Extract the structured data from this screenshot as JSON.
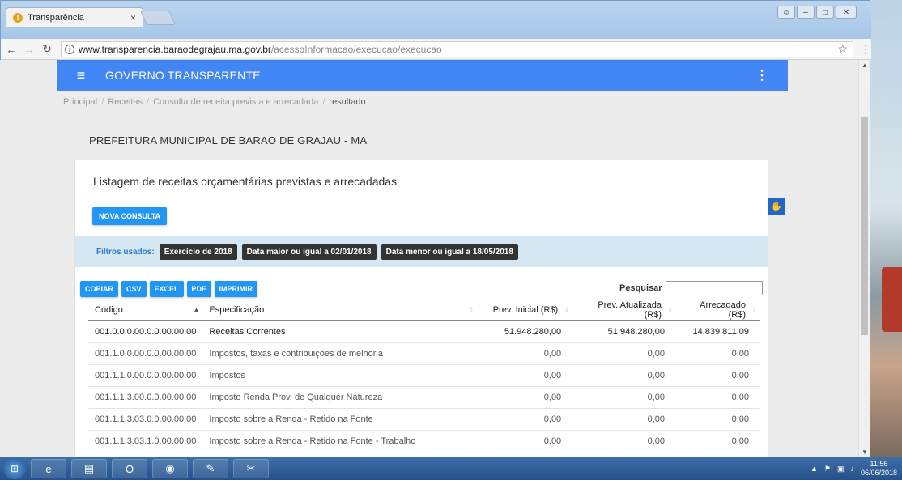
{
  "browser": {
    "tab_title": "Transparência",
    "tab_close": "×",
    "url_host": "www.transparencia.baraodegrajau.ma.gov.br",
    "url_path": "/acessoInformacao/execucao/execucao"
  },
  "app": {
    "brand": "GOVERNO TRANSPARENTE"
  },
  "breadcrumb": [
    "Principal",
    "Receitas",
    "Consulta de receita prevista e arrecadada",
    "resultado"
  ],
  "org_title": "PREFEITURA MUNICIPAL DE BARAO DE GRAJAU - MA",
  "card": {
    "title": "Listagem de receitas orçamentárias previstas e arrecadadas",
    "nova_consulta": "NOVA CONSULTA",
    "filters_label": "Filtros usados:",
    "filters": [
      "Exercício de 2018",
      "Data maior ou igual a 02/01/2018",
      "Data menor ou igual a 18/05/2018"
    ],
    "exports": [
      "COPIAR",
      "CSV",
      "EXCEL",
      "PDF",
      "IMPRIMIR"
    ],
    "search_label": "Pesquisar",
    "search_value": ""
  },
  "table": {
    "columns": [
      "Código",
      "Especificação",
      "Prev. Inicial (R$)",
      "Prev. Atualizada (R$)",
      "Arrecadado (R$)"
    ],
    "rows": [
      [
        "001.0.0.0.00.0.0.00.00.00",
        "Receitas Correntes",
        "51.948.280,00",
        "51.948.280,00",
        "14.839.811,09"
      ],
      [
        "001.1.0.0.00.0.0.00.00.00",
        "Impostos, taxas e contribuições de melhoria",
        "0,00",
        "0,00",
        "0,00"
      ],
      [
        "001.1.1.0.00.0.0.00.00.00",
        "Impostos",
        "0,00",
        "0,00",
        "0,00"
      ],
      [
        "001.1.1.3.00.0.0.00.00.00",
        "Imposto Renda Prov. de Qualquer Natureza",
        "0,00",
        "0,00",
        "0,00"
      ],
      [
        "001.1.1.3.03.0.0.00.00.00",
        "Imposto sobre a Renda - Retido na Fonte",
        "0,00",
        "0,00",
        "0,00"
      ],
      [
        "001.1.1.3.03.1.0.00.00.00",
        "Imposto sobre a Renda - Retido na Fonte - Trabalho",
        "0,00",
        "0,00",
        "0,00"
      ]
    ]
  },
  "taskbar": {
    "time": "11:56",
    "date": "06/06/2018"
  }
}
